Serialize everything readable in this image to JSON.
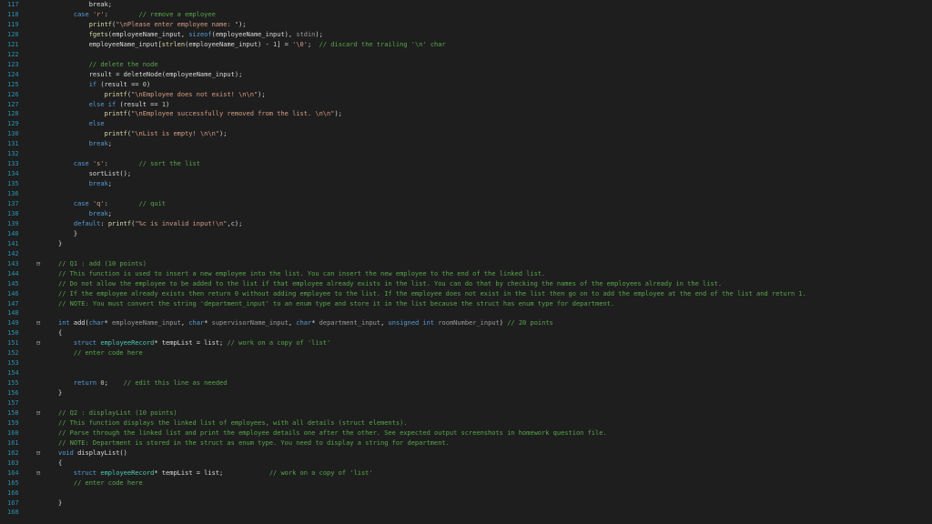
{
  "editor": {
    "lines": [
      {
        "n": "117",
        "t": [
          [
            "pl",
            "        break;"
          ]
        ]
      },
      {
        "n": "118",
        "t": [
          [
            "pl",
            "    "
          ],
          [
            "kw",
            "case"
          ],
          [
            "pl",
            " "
          ],
          [
            "str",
            "'r'"
          ],
          [
            "pl",
            ":        "
          ],
          [
            "cm",
            "// remove a employee"
          ]
        ]
      },
      {
        "n": "119",
        "t": [
          [
            "pl",
            "        "
          ],
          [
            "fn",
            "printf"
          ],
          [
            "pl",
            "("
          ],
          [
            "str",
            "\"\\nPlease enter employee name: \""
          ],
          [
            "pl",
            ");"
          ]
        ]
      },
      {
        "n": "120",
        "t": [
          [
            "pl",
            "        "
          ],
          [
            "fn",
            "fgets"
          ],
          [
            "pl",
            "(employeeName_input, "
          ],
          [
            "kw",
            "sizeof"
          ],
          [
            "pl",
            "(employeeName_input), "
          ],
          [
            "pm",
            "stdin"
          ],
          [
            "pl",
            ");"
          ]
        ]
      },
      {
        "n": "121",
        "t": [
          [
            "pl",
            "        employeeName_input["
          ],
          [
            "fn",
            "strlen"
          ],
          [
            "pl",
            "(employeeName_input) - "
          ],
          [
            "num",
            "1"
          ],
          [
            "pl",
            "] = "
          ],
          [
            "str",
            "'\\0'"
          ],
          [
            "pl",
            ";  "
          ],
          [
            "cm",
            "// discard the trailing '\\n' char"
          ]
        ]
      },
      {
        "n": "122",
        "t": []
      },
      {
        "n": "123",
        "t": [
          [
            "pl",
            "        "
          ],
          [
            "cm",
            "// delete the node"
          ]
        ]
      },
      {
        "n": "124",
        "t": [
          [
            "pl",
            "        result = deleteNode(employeeName_input);"
          ]
        ]
      },
      {
        "n": "125",
        "t": [
          [
            "pl",
            "        "
          ],
          [
            "kw",
            "if"
          ],
          [
            "pl",
            " (result == "
          ],
          [
            "num",
            "0"
          ],
          [
            "pl",
            ")"
          ]
        ]
      },
      {
        "n": "126",
        "t": [
          [
            "pl",
            "            "
          ],
          [
            "fn",
            "printf"
          ],
          [
            "pl",
            "("
          ],
          [
            "str",
            "\"\\nEmployee does not exist! \\n\\n\""
          ],
          [
            "pl",
            ");"
          ]
        ]
      },
      {
        "n": "127",
        "t": [
          [
            "pl",
            "        "
          ],
          [
            "kw",
            "else if"
          ],
          [
            "pl",
            " (result == "
          ],
          [
            "num",
            "1"
          ],
          [
            "pl",
            ")"
          ]
        ]
      },
      {
        "n": "128",
        "t": [
          [
            "pl",
            "            "
          ],
          [
            "fn",
            "printf"
          ],
          [
            "pl",
            "("
          ],
          [
            "str",
            "\"\\nEmployee successfully removed from the list. \\n\\n\""
          ],
          [
            "pl",
            ");"
          ]
        ]
      },
      {
        "n": "129",
        "t": [
          [
            "pl",
            "        "
          ],
          [
            "kw",
            "else"
          ]
        ]
      },
      {
        "n": "130",
        "t": [
          [
            "pl",
            "            "
          ],
          [
            "fn",
            "printf"
          ],
          [
            "pl",
            "("
          ],
          [
            "str",
            "\"\\nList is empty! \\n\\n\""
          ],
          [
            "pl",
            ");"
          ]
        ]
      },
      {
        "n": "131",
        "t": [
          [
            "pl",
            "        "
          ],
          [
            "kw",
            "break"
          ],
          [
            "pl",
            ";"
          ]
        ]
      },
      {
        "n": "132",
        "t": []
      },
      {
        "n": "133",
        "t": [
          [
            "pl",
            "    "
          ],
          [
            "kw",
            "case"
          ],
          [
            "pl",
            " "
          ],
          [
            "str",
            "'s'"
          ],
          [
            "pl",
            ":        "
          ],
          [
            "cm",
            "// sort the list"
          ]
        ]
      },
      {
        "n": "134",
        "t": [
          [
            "pl",
            "        sortList();"
          ]
        ]
      },
      {
        "n": "135",
        "t": [
          [
            "pl",
            "        "
          ],
          [
            "kw",
            "break"
          ],
          [
            "pl",
            ";"
          ]
        ]
      },
      {
        "n": "136",
        "t": []
      },
      {
        "n": "137",
        "t": [
          [
            "pl",
            "    "
          ],
          [
            "kw",
            "case"
          ],
          [
            "pl",
            " "
          ],
          [
            "str",
            "'q'"
          ],
          [
            "pl",
            ":        "
          ],
          [
            "cm",
            "// quit"
          ]
        ]
      },
      {
        "n": "138",
        "t": [
          [
            "pl",
            "        "
          ],
          [
            "kw",
            "break"
          ],
          [
            "pl",
            ";"
          ]
        ]
      },
      {
        "n": "139",
        "t": [
          [
            "pl",
            "    "
          ],
          [
            "kw",
            "default"
          ],
          [
            "pl",
            ": "
          ],
          [
            "fn",
            "printf"
          ],
          [
            "pl",
            "("
          ],
          [
            "str",
            "\"%c is invalid input!\\n\""
          ],
          [
            "pl",
            ",c);"
          ]
        ]
      },
      {
        "n": "140",
        "t": [
          [
            "pl",
            "    }"
          ]
        ]
      },
      {
        "n": "141",
        "t": [
          [
            "pl",
            "}"
          ]
        ]
      },
      {
        "n": "142",
        "t": []
      },
      {
        "n": "143",
        "f": "⊟",
        "t": [
          [
            "cm",
            "// Q1 : add (10 points)"
          ]
        ]
      },
      {
        "n": "144",
        "t": [
          [
            "cm",
            "// This function is used to insert a new employee into the list. You can insert the new employee to the end of the linked list."
          ]
        ]
      },
      {
        "n": "145",
        "t": [
          [
            "cm",
            "// Do not allow the employee to be added to the list if that employee already exists in the list. You can do that by checking the names of the employees already in the list."
          ]
        ]
      },
      {
        "n": "146",
        "t": [
          [
            "cm",
            "// If the employee already exists then return 0 without adding employee to the list. If the employee does not exist in the list then go on to add the employee at the end of the list and return 1."
          ]
        ]
      },
      {
        "n": "147",
        "t": [
          [
            "cm",
            "// NOTE: You must convert the string 'department_input' to an enum type and store it in the list because the struct has enum type for department."
          ]
        ]
      },
      {
        "n": "148",
        "t": []
      },
      {
        "n": "149",
        "f": "⊟",
        "t": [
          [
            "kw",
            "int"
          ],
          [
            "pl",
            " add("
          ],
          [
            "kw",
            "char"
          ],
          [
            "pl",
            "* "
          ],
          [
            "pm",
            "employeeName_input"
          ],
          [
            "pl",
            ", "
          ],
          [
            "kw",
            "char"
          ],
          [
            "pl",
            "* "
          ],
          [
            "pm",
            "supervisorName_input"
          ],
          [
            "pl",
            ", "
          ],
          [
            "kw",
            "char"
          ],
          [
            "pl",
            "* "
          ],
          [
            "pm",
            "department_input"
          ],
          [
            "pl",
            ", "
          ],
          [
            "kw",
            "unsigned int"
          ],
          [
            "pl",
            " "
          ],
          [
            "pm",
            "roomNumber_input"
          ],
          [
            "pl",
            ") "
          ],
          [
            "cm",
            "// 20 points"
          ]
        ]
      },
      {
        "n": "150",
        "t": [
          [
            "pl",
            "{"
          ]
        ]
      },
      {
        "n": "151",
        "f": "⊟",
        "t": [
          [
            "pl",
            "    "
          ],
          [
            "kw",
            "struct"
          ],
          [
            "pl",
            " "
          ],
          [
            "ty",
            "employeeRecord"
          ],
          [
            "pl",
            "* tempList = list; "
          ],
          [
            "cm",
            "// work on a copy of 'list'"
          ]
        ]
      },
      {
        "n": "152",
        "t": [
          [
            "pl",
            "    "
          ],
          [
            "cm",
            "// enter code here"
          ]
        ]
      },
      {
        "n": "153",
        "t": []
      },
      {
        "n": "154",
        "t": []
      },
      {
        "n": "155",
        "t": [
          [
            "pl",
            "    "
          ],
          [
            "kw",
            "return"
          ],
          [
            "pl",
            " "
          ],
          [
            "num",
            "0"
          ],
          [
            "pl",
            ";    "
          ],
          [
            "cm",
            "// edit this line as needed"
          ]
        ]
      },
      {
        "n": "156",
        "t": [
          [
            "pl",
            "}"
          ]
        ]
      },
      {
        "n": "157",
        "t": []
      },
      {
        "n": "158",
        "f": "⊟",
        "t": [
          [
            "cm",
            "// Q2 : displayList (10 points)"
          ]
        ]
      },
      {
        "n": "159",
        "t": [
          [
            "cm",
            "// This function displays the linked list of employees, with all details (struct elements)."
          ]
        ]
      },
      {
        "n": "160",
        "t": [
          [
            "cm",
            "// Parse through the linked list and print the employee details one after the other. See expected output screenshots in homework question file."
          ]
        ]
      },
      {
        "n": "161",
        "t": [
          [
            "cm",
            "// NOTE: Department is stored in the struct as enum type. You need to display a string for department."
          ]
        ]
      },
      {
        "n": "162",
        "f": "⊟",
        "t": [
          [
            "kw",
            "void"
          ],
          [
            "pl",
            " displayList()"
          ]
        ]
      },
      {
        "n": "163",
        "t": [
          [
            "pl",
            "{"
          ]
        ]
      },
      {
        "n": "164",
        "f": "⊟",
        "t": [
          [
            "pl",
            "    "
          ],
          [
            "kw",
            "struct"
          ],
          [
            "pl",
            " "
          ],
          [
            "ty",
            "employeeRecord"
          ],
          [
            "pl",
            "* tempList = list;            "
          ],
          [
            "cm",
            "// work on a copy of 'list'"
          ]
        ]
      },
      {
        "n": "165",
        "t": [
          [
            "pl",
            "    "
          ],
          [
            "cm",
            "// enter code here"
          ]
        ]
      },
      {
        "n": "166",
        "t": []
      },
      {
        "n": "167",
        "t": [
          [
            "pl",
            "}"
          ]
        ]
      },
      {
        "n": "168",
        "t": []
      }
    ]
  },
  "colors": {
    "background": "#1e1e1e",
    "line_number": "#2b91af",
    "keyword": "#569cd6",
    "comment": "#57a64a",
    "string": "#d69d85",
    "plain": "#dcdcdc"
  }
}
